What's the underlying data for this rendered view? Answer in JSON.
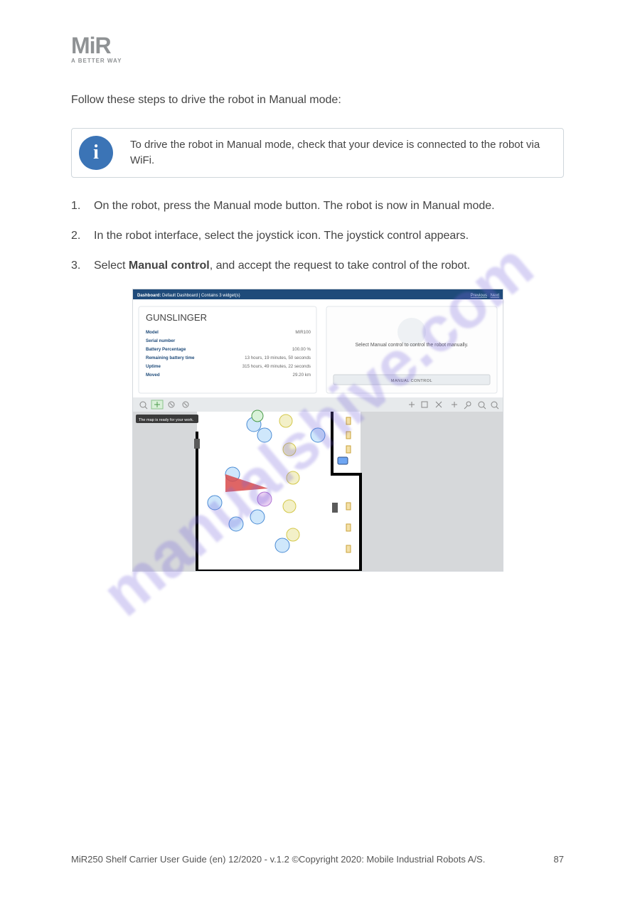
{
  "logo": {
    "letters": "MiR",
    "tagline": "A BETTER WAY"
  },
  "intro_sentence": "Follow these steps to drive the robot in Manual mode:",
  "info_note": "To drive the robot in Manual mode, check that your device is connected to the robot via WiFi.",
  "steps": [
    {
      "num": "1.",
      "text_pre": "On the robot, press the Manual mode button. The robot is now in Manual mode."
    },
    {
      "num": "2.",
      "text_pre": "In the robot interface, select the joystick icon. The joystick control appears."
    },
    {
      "num": "3.",
      "text_pre": "Select ",
      "bold": "Manual control",
      "text_post": ", and accept the request to take control of the robot."
    }
  ],
  "breadcrumb": {
    "label": "Dashboard:",
    "value": "Default Dashboard",
    "widgets": "Contains 3 widget(s)",
    "prev": "Previous",
    "next": "Next"
  },
  "panel": {
    "title": "GUNSLINGER",
    "rows": [
      {
        "label": "Model",
        "value": "MIR100"
      },
      {
        "label": "Serial number",
        "value": ""
      },
      {
        "label": "Battery Percentage",
        "value": "100.00 %"
      },
      {
        "label": "Remaining battery time",
        "value": "13 hours, 19 minutes, 50 seconds"
      },
      {
        "label": "Uptime",
        "value": "315 hours, 49 minutes, 22 seconds"
      },
      {
        "label": "Moved",
        "value": "29.20 km"
      }
    ]
  },
  "control_text": "Select Manual control to control the robot manually.",
  "control_btn": "MANUAL CONTROL",
  "map_hint": "The map is ready for your work.",
  "footer": {
    "left": "MiR250 Shelf Carrier User Guide (en) 12/2020 - v.1.2 ©Copyright 2020: Mobile Industrial Robots A/S.",
    "right": "87"
  },
  "watermark_text": "manualshive.com"
}
